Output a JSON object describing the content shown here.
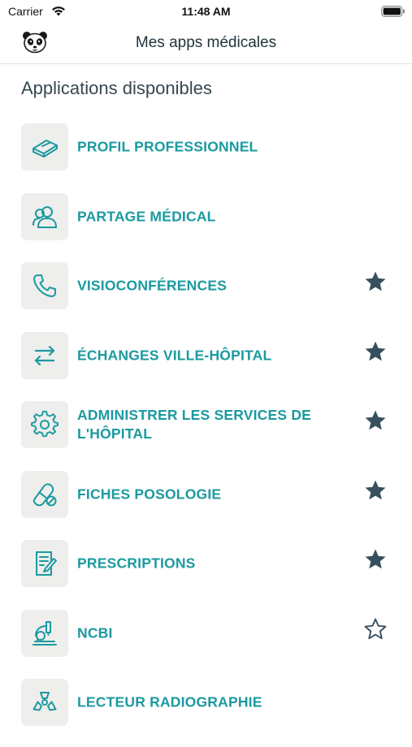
{
  "status_bar": {
    "carrier": "Carrier",
    "time": "11:48 AM"
  },
  "nav": {
    "title": "Mes apps médicales"
  },
  "section": {
    "title": "Applications disponibles"
  },
  "colors": {
    "accent": "#1b9aa0",
    "star": "#37505c",
    "tile": "#eeeeec"
  },
  "apps": [
    {
      "label": "PROFIL PROFESSIONNEL",
      "icon": "id-card-icon",
      "favorite": null
    },
    {
      "label": "PARTAGE MÉDICAL",
      "icon": "users-icon",
      "favorite": null
    },
    {
      "label": "VISIOCONFÉRENCES",
      "icon": "phone-icon",
      "favorite": true
    },
    {
      "label": "ÉCHANGES VILLE-HÔPITAL",
      "icon": "exchange-arrows-icon",
      "favorite": true
    },
    {
      "label": "ADMINISTRER LES SERVICES DE L'HÔPITAL",
      "icon": "gear-icon",
      "favorite": true
    },
    {
      "label": "FICHES POSOLOGIE",
      "icon": "pill-icon",
      "favorite": true
    },
    {
      "label": "PRESCRIPTIONS",
      "icon": "prescription-icon",
      "favorite": true
    },
    {
      "label": "NCBI",
      "icon": "microscope-icon",
      "favorite": false
    },
    {
      "label": "LECTEUR RADIOGRAPHIE",
      "icon": "radiation-icon",
      "favorite": null
    }
  ]
}
